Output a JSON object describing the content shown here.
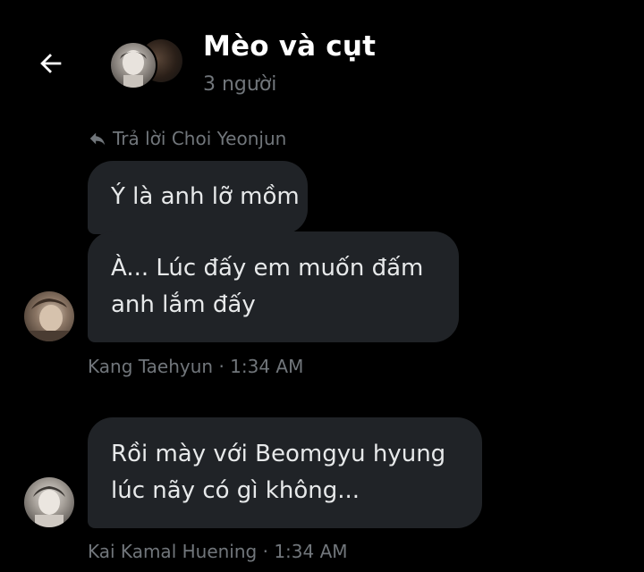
{
  "header": {
    "title": "Mèo và cụt",
    "subtitle": "3 người",
    "icons": {
      "back": "arrow-left-icon",
      "group": "group-avatar"
    }
  },
  "messages": [
    {
      "reply_label": "Trả lời Choi Yeonjun",
      "bubbles": [
        {
          "lines": [
            "Ý là anh lỡ mồm"
          ]
        },
        {
          "lines": [
            "À... Lúc đấy em muốn đấm",
            "anh lắm đấy"
          ]
        }
      ],
      "sender": "Kang Taehyun",
      "separator": "·",
      "time": "1:34 AM"
    },
    {
      "bubbles": [
        {
          "lines": [
            "Rồi mày với Beomgyu hyung",
            "lúc nãy có gì không..."
          ]
        }
      ],
      "sender": "Kai Kamal Huening",
      "separator": "·",
      "time": "1:34 AM"
    }
  ],
  "colors": {
    "background": "#000000",
    "bubble": "#202327",
    "text": "#e7e9ea",
    "muted": "#71767b"
  }
}
